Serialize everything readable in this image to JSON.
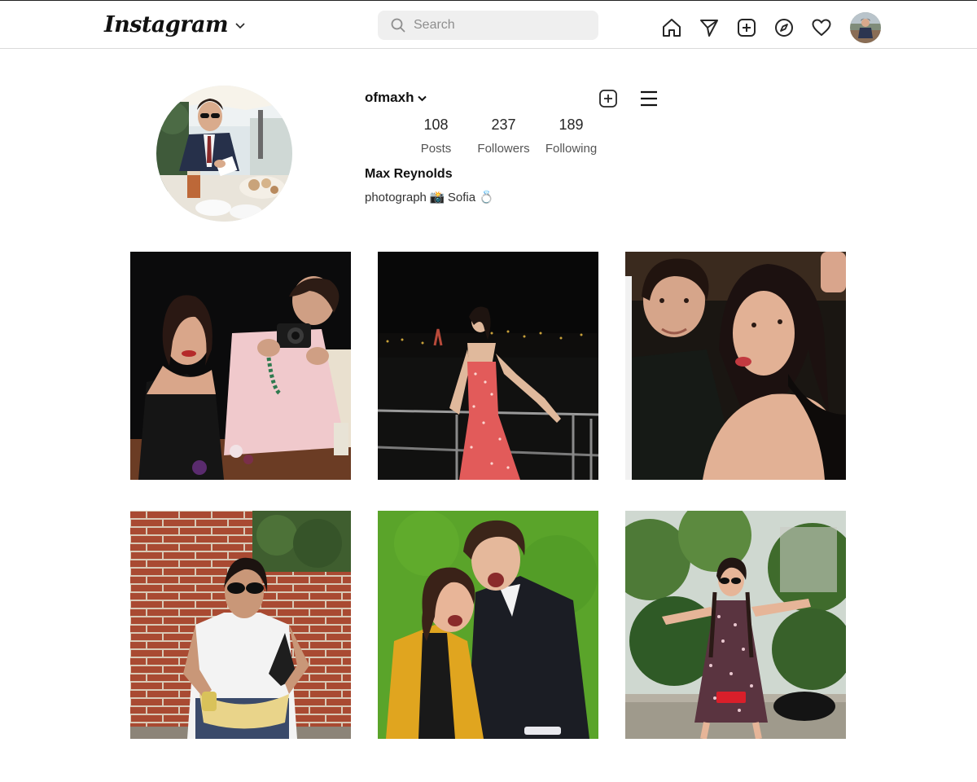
{
  "app": {
    "logo_text": "Instagram"
  },
  "search": {
    "placeholder": "Search"
  },
  "nav": {
    "icons": [
      "home-icon",
      "direct-message-icon",
      "new-post-icon",
      "explore-icon",
      "activity-heart-icon",
      "profile-avatar"
    ]
  },
  "profile": {
    "username": "ofmaxh",
    "stats": [
      {
        "count": "108",
        "label": "Posts"
      },
      {
        "count": "237",
        "label": "Followers"
      },
      {
        "count": "189",
        "label": "Following"
      }
    ],
    "full_name": "Max Reynolds",
    "bio": {
      "text1": "photograph",
      "emoji1": "📸",
      "text2": "Sofia",
      "emoji2": "💍"
    }
  },
  "colors": {
    "border": "#dbdbdb",
    "search_bg": "#efefef",
    "text": "#262626",
    "muted": "#8e8e8e"
  },
  "posts": [
    {
      "id": "post-1",
      "scene": "dinner-couple-camera"
    },
    {
      "id": "post-2",
      "scene": "night-boat-red-dress"
    },
    {
      "id": "post-3",
      "scene": "party-couple-flash"
    },
    {
      "id": "post-4",
      "scene": "brick-wall-sunglasses"
    },
    {
      "id": "post-5",
      "scene": "green-backdrop-couple"
    },
    {
      "id": "post-6",
      "scene": "park-floral-dress"
    }
  ]
}
